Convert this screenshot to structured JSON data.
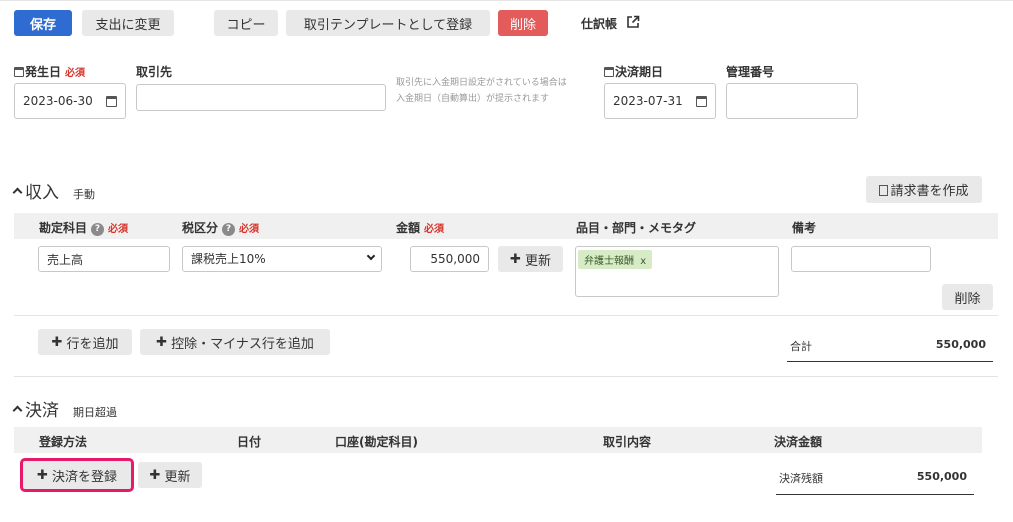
{
  "toolbar": {
    "save": "保存",
    "change_to_expense": "支出に変更",
    "copy": "コピー",
    "register_template": "取引テンプレートとして登録",
    "delete": "削除",
    "journal": "仕訳帳"
  },
  "header_form": {
    "issue_date_label": "発生日",
    "required": "必須",
    "issue_date_value": "2023-06-30",
    "partner_label": "取引先",
    "partner_value": "",
    "partner_hint_1": "取引先に入金期日設定がされている場合は",
    "partner_hint_2": "入金期日（自動算出）が提示されます",
    "due_date_label": "決済期日",
    "due_date_value": "2023-07-31",
    "ref_number_label": "管理番号",
    "ref_number_value": ""
  },
  "income": {
    "title": "収入",
    "mode": "手動",
    "create_invoice": "請求書を作成",
    "columns": {
      "account": "勘定科目",
      "tax": "税区分",
      "amount": "金額",
      "tags": "品目・部門・メモタグ",
      "note": "備考"
    },
    "row": {
      "account": "売上高",
      "tax": "課税売上10%",
      "amount": "550,000",
      "update": "更新",
      "tag": "弁護士報酬",
      "tag_remove": "x",
      "note": "",
      "delete": "削除"
    },
    "add_row": "行を追加",
    "add_deduction_row": "控除・マイナス行を追加",
    "total_label": "合計",
    "total_value": "550,000"
  },
  "settlement": {
    "title": "決済",
    "status": "期日超過",
    "columns": {
      "method": "登録方法",
      "date": "日付",
      "account": "口座(勘定科目)",
      "content": "取引内容",
      "amount": "決済金額"
    },
    "register": "決済を登録",
    "update": "更新",
    "remaining_label": "決済残額",
    "remaining_value": "550,000"
  },
  "colors": {
    "primary": "#2f6cd2",
    "danger": "#e35b5b",
    "highlight": "#e8196b",
    "tag_bg": "#d7ebc6"
  }
}
